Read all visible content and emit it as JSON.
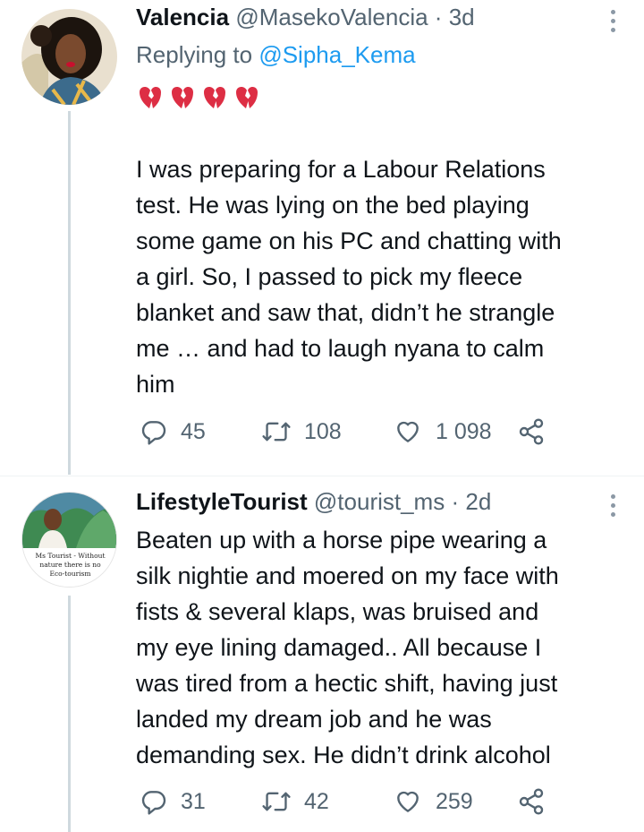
{
  "tweets": [
    {
      "name": "Valencia",
      "handle": "@MasekoValencia",
      "separator": "·",
      "time": "3d",
      "reply_prefix": "Replying to",
      "reply_to": "@Sipha_Kema",
      "emoji": "💔💔💔💔",
      "lines": [
        "I was preparing for a Labour Relations",
        "test. He was lying on the bed playing",
        "some game on his PC and chatting with",
        "a girl. So, I passed to  pick my fleece",
        "blanket and saw that, didn’t he strangle",
        "me … and had to laugh nyana to calm",
        "him"
      ],
      "replies": "45",
      "retweets": "108",
      "likes": "1 098"
    },
    {
      "name": "LifestyleTourist",
      "handle": "@tourist_ms",
      "separator": "·",
      "time": "2d",
      "avatar_caption": [
        "Ms Tourist - Without",
        "nature there is no",
        "Eco-tourism"
      ],
      "lines": [
        "Beaten up with a horse pipe wearing a",
        "silk nightie and moered on my face with",
        "fists & several klaps, was bruised and",
        "my eye lining damaged.. All because I",
        "was tired from a hectic shift, having just",
        "landed my dream job and he was",
        "demanding sex. He didn’t drink alcohol"
      ],
      "replies": "31",
      "retweets": "42",
      "likes": "259"
    }
  ],
  "colors": {
    "text": "#0f1419",
    "secondary": "#536471",
    "link": "#1d9bf0",
    "heart": "#e0245e"
  },
  "icons": [
    "more-icon",
    "reply-icon",
    "retweet-icon",
    "like-icon",
    "share-icon",
    "broken-heart-icon"
  ]
}
